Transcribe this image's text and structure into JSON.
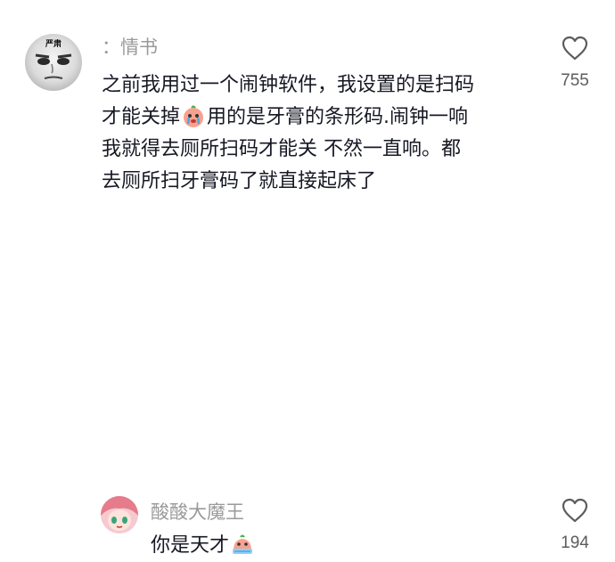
{
  "comments": [
    {
      "username": "：情书",
      "avatar_text": "严肃",
      "lines": [
        {
          "text": "之前我用过一个闹钟软件，我设置的是扫码"
        },
        {
          "before": "才能关掉",
          "emoji": "crying-face-emoji",
          "after": "用的是牙膏的条形码.闹钟一响"
        },
        {
          "text": "我就得去厕所扫码才能关 不然一直响。都"
        },
        {
          "text": "去厕所扫牙膏码了就直接起床了"
        }
      ],
      "like_count": "755",
      "like_icon": "heart-outline-icon"
    },
    {
      "username": "酸酸大魔王",
      "lines": [
        {
          "before": "你是天才",
          "emoji": "crying-face-emoji"
        }
      ],
      "like_count": "194",
      "like_icon": "heart-outline-icon"
    }
  ],
  "colors": {
    "username": "#9a9a9a",
    "text": "#161823",
    "count": "#5c5c5c",
    "background": "#ffffff"
  }
}
